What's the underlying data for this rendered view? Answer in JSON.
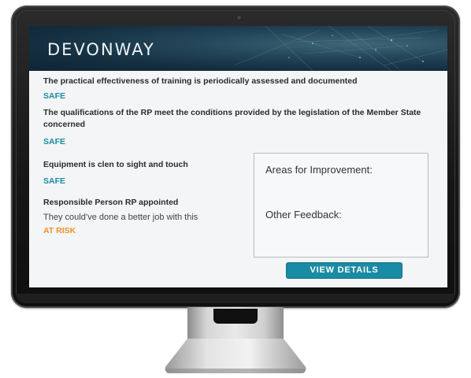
{
  "brand": {
    "logo_text": "DEVONWAY"
  },
  "items": [
    {
      "title": "The practical effectiveness of training is periodically assessed and documented",
      "status": "SAFE"
    },
    {
      "title": "The qualifications of the RP meet the conditions provided by the legislation of the Member State concerned",
      "status": "SAFE"
    },
    {
      "title": "Equipment is clen to sight and touch",
      "status": "SAFE"
    },
    {
      "title": "Responsible Person RP appointed",
      "note": "They could’ve done a better job with this",
      "status": "AT RISK"
    }
  ],
  "feedback_panel": {
    "areas_label": "Areas for Improvement:",
    "other_label": "Other Feedback:"
  },
  "actions": {
    "view_details_label": "VIEW DETAILS"
  },
  "colors": {
    "safe": "#1a8ba4",
    "at_risk": "#f0922a",
    "button": "#1a8ba4",
    "header": "#1b3a4e"
  }
}
